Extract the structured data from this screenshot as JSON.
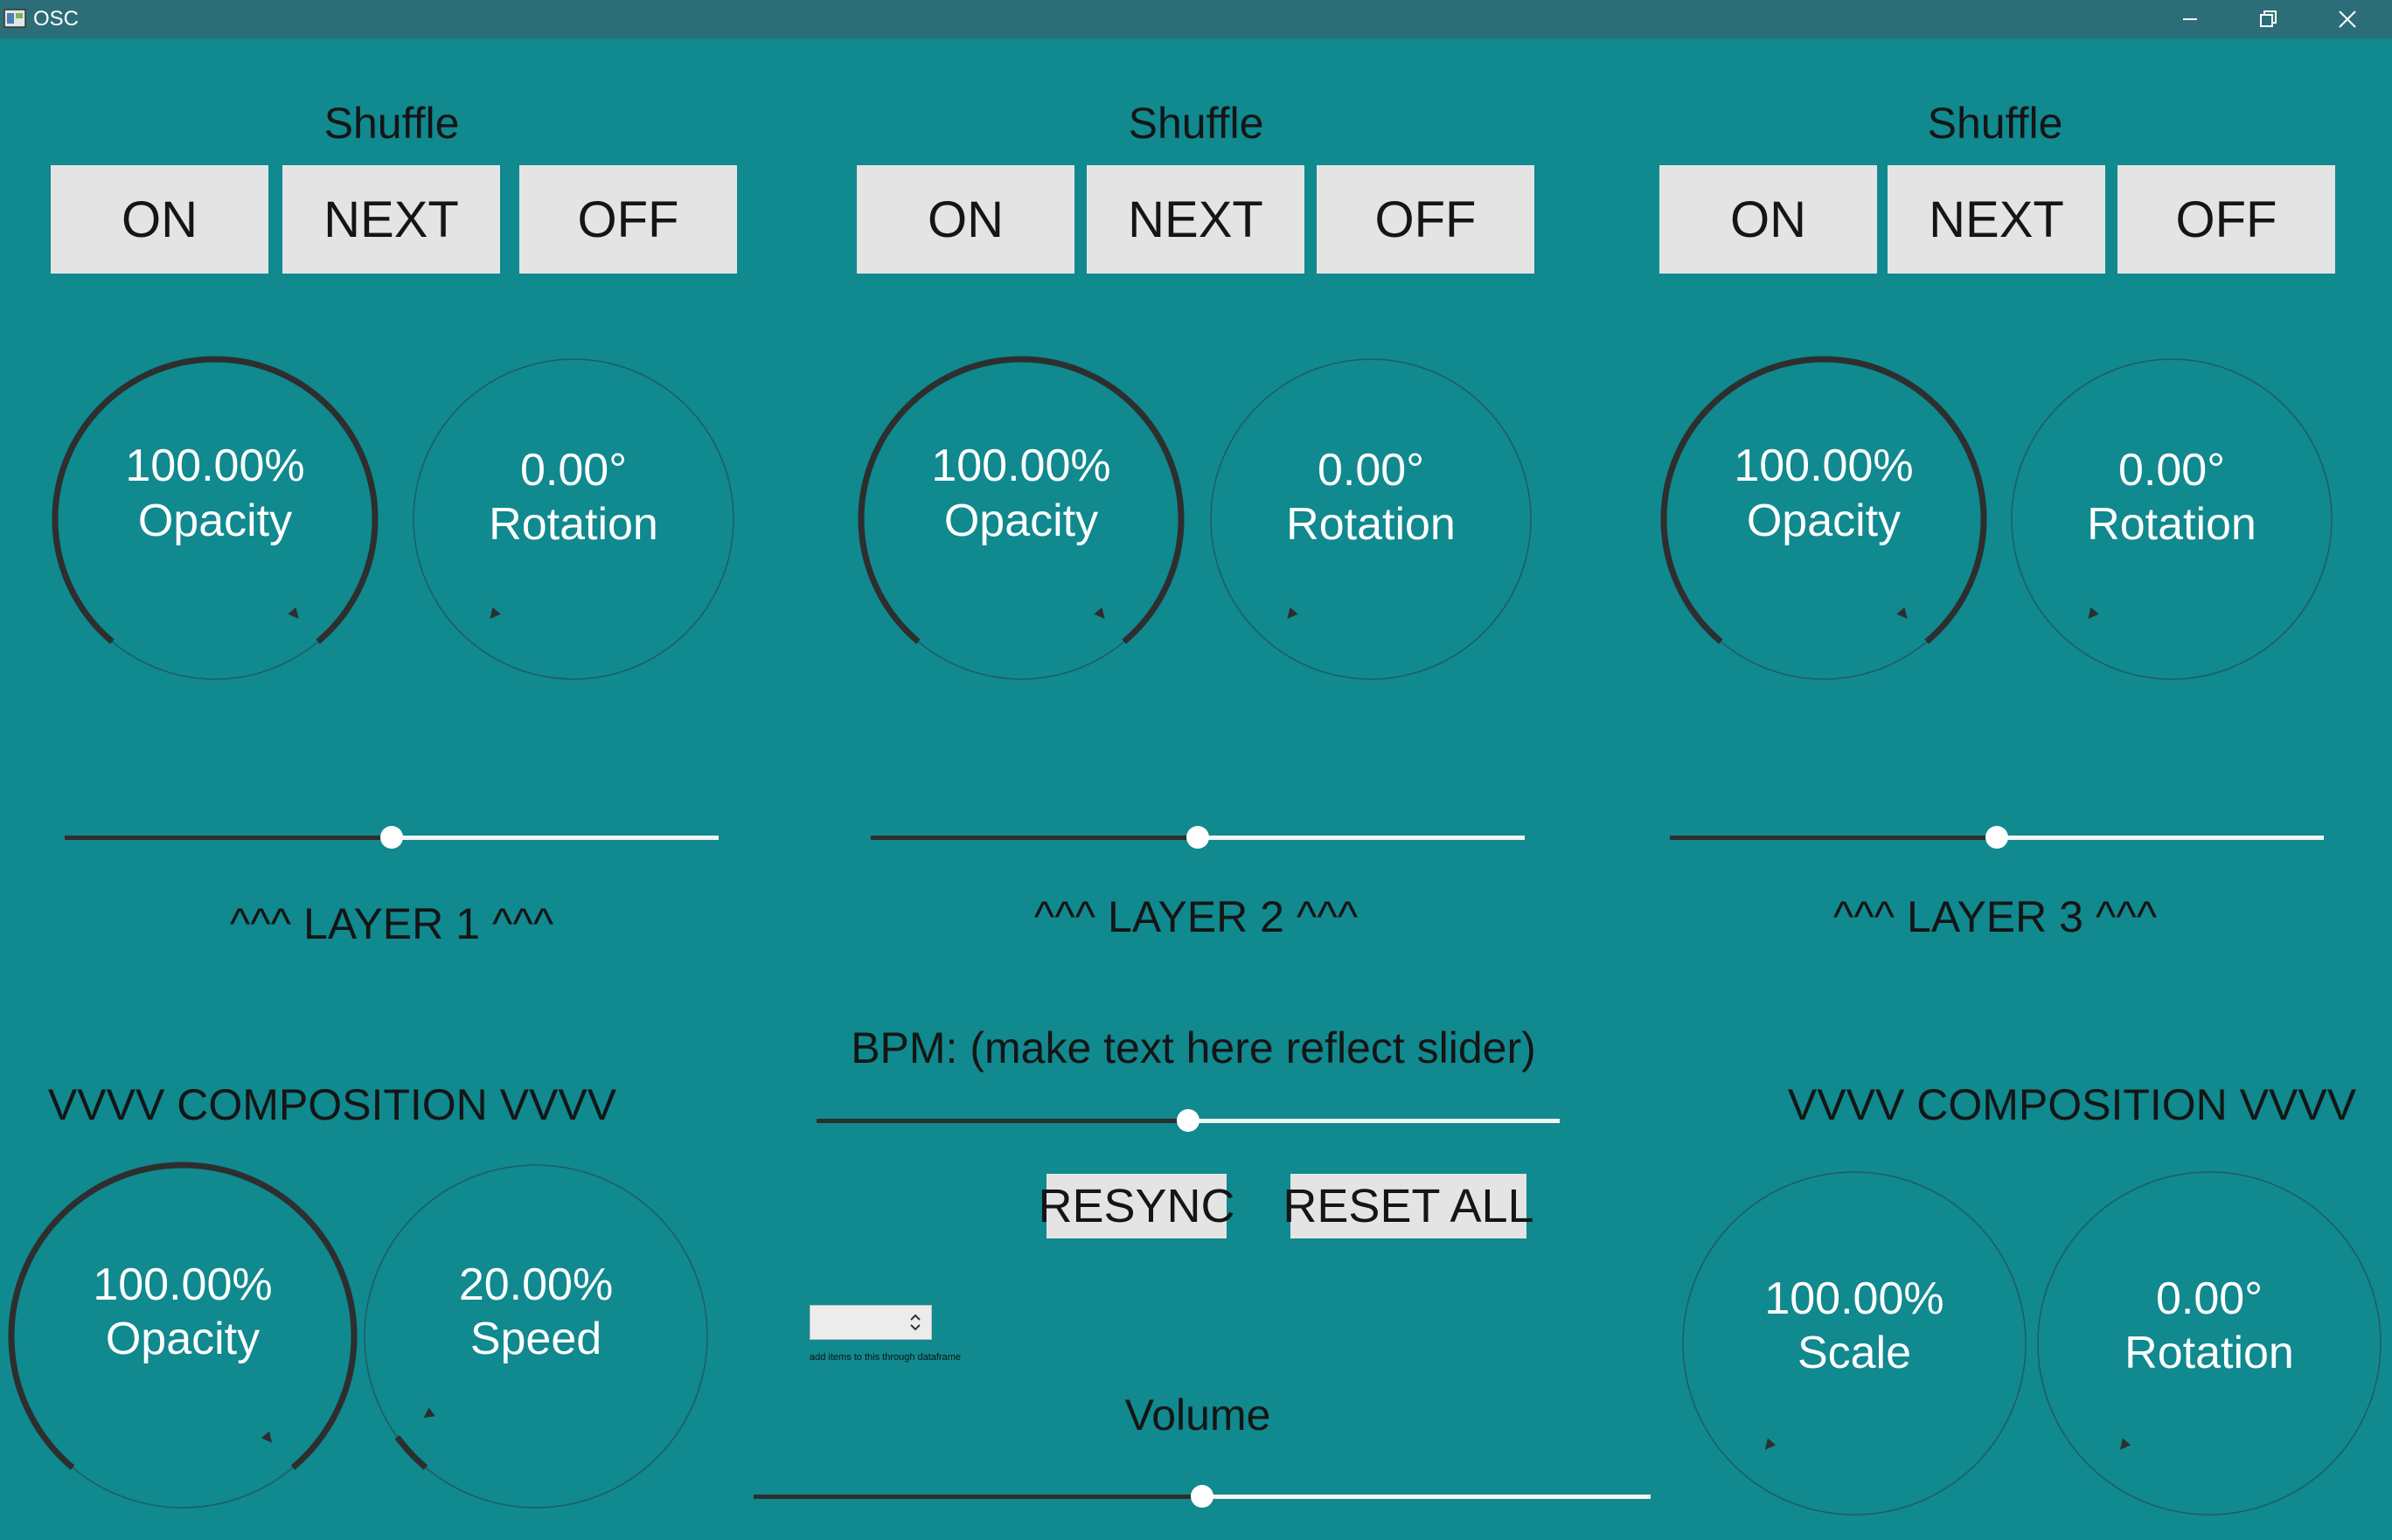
{
  "window": {
    "title": "OSC",
    "controls": [
      "minimize-icon",
      "restore-icon",
      "close-icon"
    ]
  },
  "colors": {
    "background": "#10898f",
    "titlebar": "#2c6e78",
    "button": "#e4e4e4",
    "knob_arc": "#2e2e2e",
    "knob_outline": "#1d5d62",
    "text_light": "#ffffff",
    "text_dark": "#151515"
  },
  "layers": [
    {
      "shuffle_label": "Shuffle",
      "buttons": [
        "ON",
        "NEXT",
        "OFF"
      ],
      "opacity_knob": {
        "value": "100.00%",
        "name": "Opacity"
      },
      "rotation_knob": {
        "value": "0.00°",
        "name": "Rotation"
      },
      "slider_position": 0.5,
      "label": "^^^ LAYER 1 ^^^"
    },
    {
      "shuffle_label": "Shuffle",
      "buttons": [
        "ON",
        "NEXT",
        "OFF"
      ],
      "opacity_knob": {
        "value": "100.00%",
        "name": "Opacity"
      },
      "rotation_knob": {
        "value": "0.00°",
        "name": "Rotation"
      },
      "slider_position": 0.5,
      "label": "^^^ LAYER 2 ^^^"
    },
    {
      "shuffle_label": "Shuffle",
      "buttons": [
        "ON",
        "NEXT",
        "OFF"
      ],
      "opacity_knob": {
        "value": "100.00%",
        "name": "Opacity"
      },
      "rotation_knob": {
        "value": "0.00°",
        "name": "Rotation"
      },
      "slider_position": 0.5,
      "label": "^^^ LAYER 3 ^^^"
    }
  ],
  "composition_left": {
    "label": "VVVV COMPOSITION VVVV",
    "opacity_knob": {
      "value": "100.00%",
      "name": "Opacity"
    },
    "speed_knob": {
      "value": "20.00%",
      "name": "Speed"
    }
  },
  "composition_right": {
    "label": "VVVV COMPOSITION VVVV",
    "scale_knob": {
      "value": "100.00%",
      "name": "Scale"
    },
    "rotation_knob": {
      "value": "0.00°",
      "name": "Rotation"
    }
  },
  "center": {
    "bpm_label": "BPM: (make text here reflect slider)",
    "bpm_slider_position": 0.5,
    "resync_label": "RESYNC",
    "reset_all_label": "RESET ALL",
    "dropdown_value": "",
    "dropdown_hint": "add items to this through dataframe",
    "volume_label": "Volume",
    "volume_slider_position": 0.5
  }
}
